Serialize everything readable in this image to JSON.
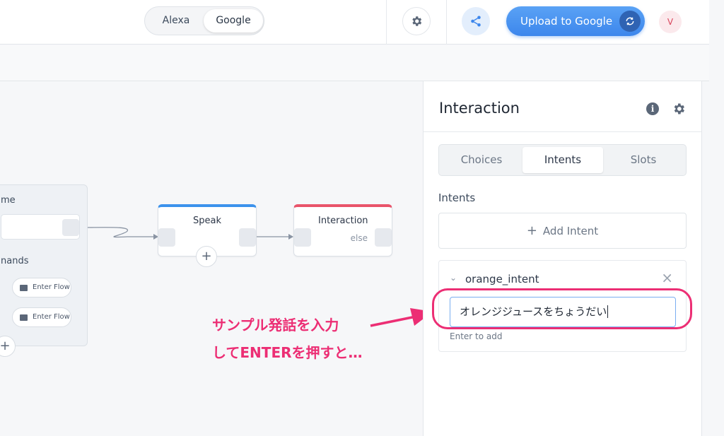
{
  "topbar": {
    "platform_toggle": {
      "alexa": "Alexa",
      "google": "Google",
      "selected": "Google"
    },
    "upload_label": "Upload to Google",
    "avatar_initial": "V"
  },
  "canvas": {
    "home_block": {
      "title_partial": "me",
      "commands_partial": "nands",
      "enter_flow_1": "Enter Flow",
      "enter_flow_2": "Enter Flow"
    },
    "speak_node": {
      "title": "Speak"
    },
    "interaction_node": {
      "title": "Interaction",
      "else_label": "else"
    },
    "annotation_line1": "サンプル発話を入力",
    "annotation_line2": "してENTERを押すと…"
  },
  "panel": {
    "title": "Interaction",
    "tabs": [
      {
        "label": "Choices",
        "active": false
      },
      {
        "label": "Intents",
        "active": true
      },
      {
        "label": "Slots",
        "active": false
      }
    ],
    "section_label": "Intents",
    "add_intent_label": "Add Intent",
    "intent": {
      "name": "orange_intent",
      "utterance_value": "オレンジジュースをちょうだい",
      "hint": "Enter to add"
    }
  },
  "colors": {
    "accent_blue": "#3c86ec",
    "speak_bar": "#3c92ec",
    "interaction_bar": "#e9546b",
    "annotation": "#ec2e74"
  }
}
